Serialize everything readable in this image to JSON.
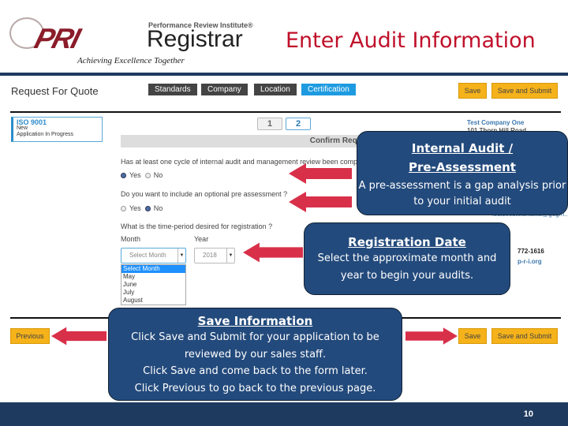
{
  "slide": {
    "title": "Enter Audit Information",
    "page_number": "10"
  },
  "logo": {
    "brand": "PRI",
    "institute": "Performance Review Institute®",
    "registrar": "Registrar",
    "tagline": "Achieving Excellence Together"
  },
  "form": {
    "heading": "Request For Quote",
    "steps": [
      {
        "label": "Standards",
        "active": false
      },
      {
        "label": "Company",
        "active": false
      },
      {
        "label": "Location",
        "active": false
      },
      {
        "label": "Certification",
        "active": true
      }
    ],
    "save_label": "Save",
    "save_submit_label": "Save and Submit",
    "previous_label": "Previous",
    "app_card": {
      "standard": "ISO 9001",
      "type": "New",
      "status": "Application In Progress"
    },
    "pages": [
      "1",
      "2"
    ],
    "section_title": "Confirm Request",
    "q1": {
      "text": "Has at least one cycle of internal audit and management review been comp",
      "yes": "Yes",
      "no": "No",
      "selected": "Yes"
    },
    "q2": {
      "text": "Do you want to include an optional pre assessment ?",
      "yes": "Yes",
      "no": "No",
      "selected": "No"
    },
    "q3": {
      "text": "What is the time-period desired for registration ?",
      "month_label": "Month",
      "year_label": "Year",
      "month_value": "Select Month",
      "year_value": "2018",
      "month_options": [
        "Select Month",
        "May",
        "June",
        "July",
        "August"
      ]
    },
    "company": {
      "name": "Test Company One",
      "address": "101 Thorn Hill Road",
      "email": "louiseestelantakis@gogm...",
      "phone": "772-1616",
      "web": "p-r-i.org"
    }
  },
  "callouts": {
    "audit": {
      "title": "Internal Audit / Pre-Assessment",
      "body": "A pre-assessment is a gap analysis prior to your initial audit"
    },
    "date": {
      "title": "Registration Date",
      "body": "Select the approximate month and year to begin your audits."
    },
    "save": {
      "title": "Save Information",
      "lines": [
        "Click Save and Submit for your application to be reviewed by our sales staff.",
        "Click Save and come back to the form later.",
        "Click Previous to go back to the previous page."
      ]
    }
  },
  "colors": {
    "callout": "#234a7c",
    "arrow": "#d9304a",
    "button": "#f5b21a",
    "title": "#c0102a",
    "footer": "#1f3a5f"
  }
}
